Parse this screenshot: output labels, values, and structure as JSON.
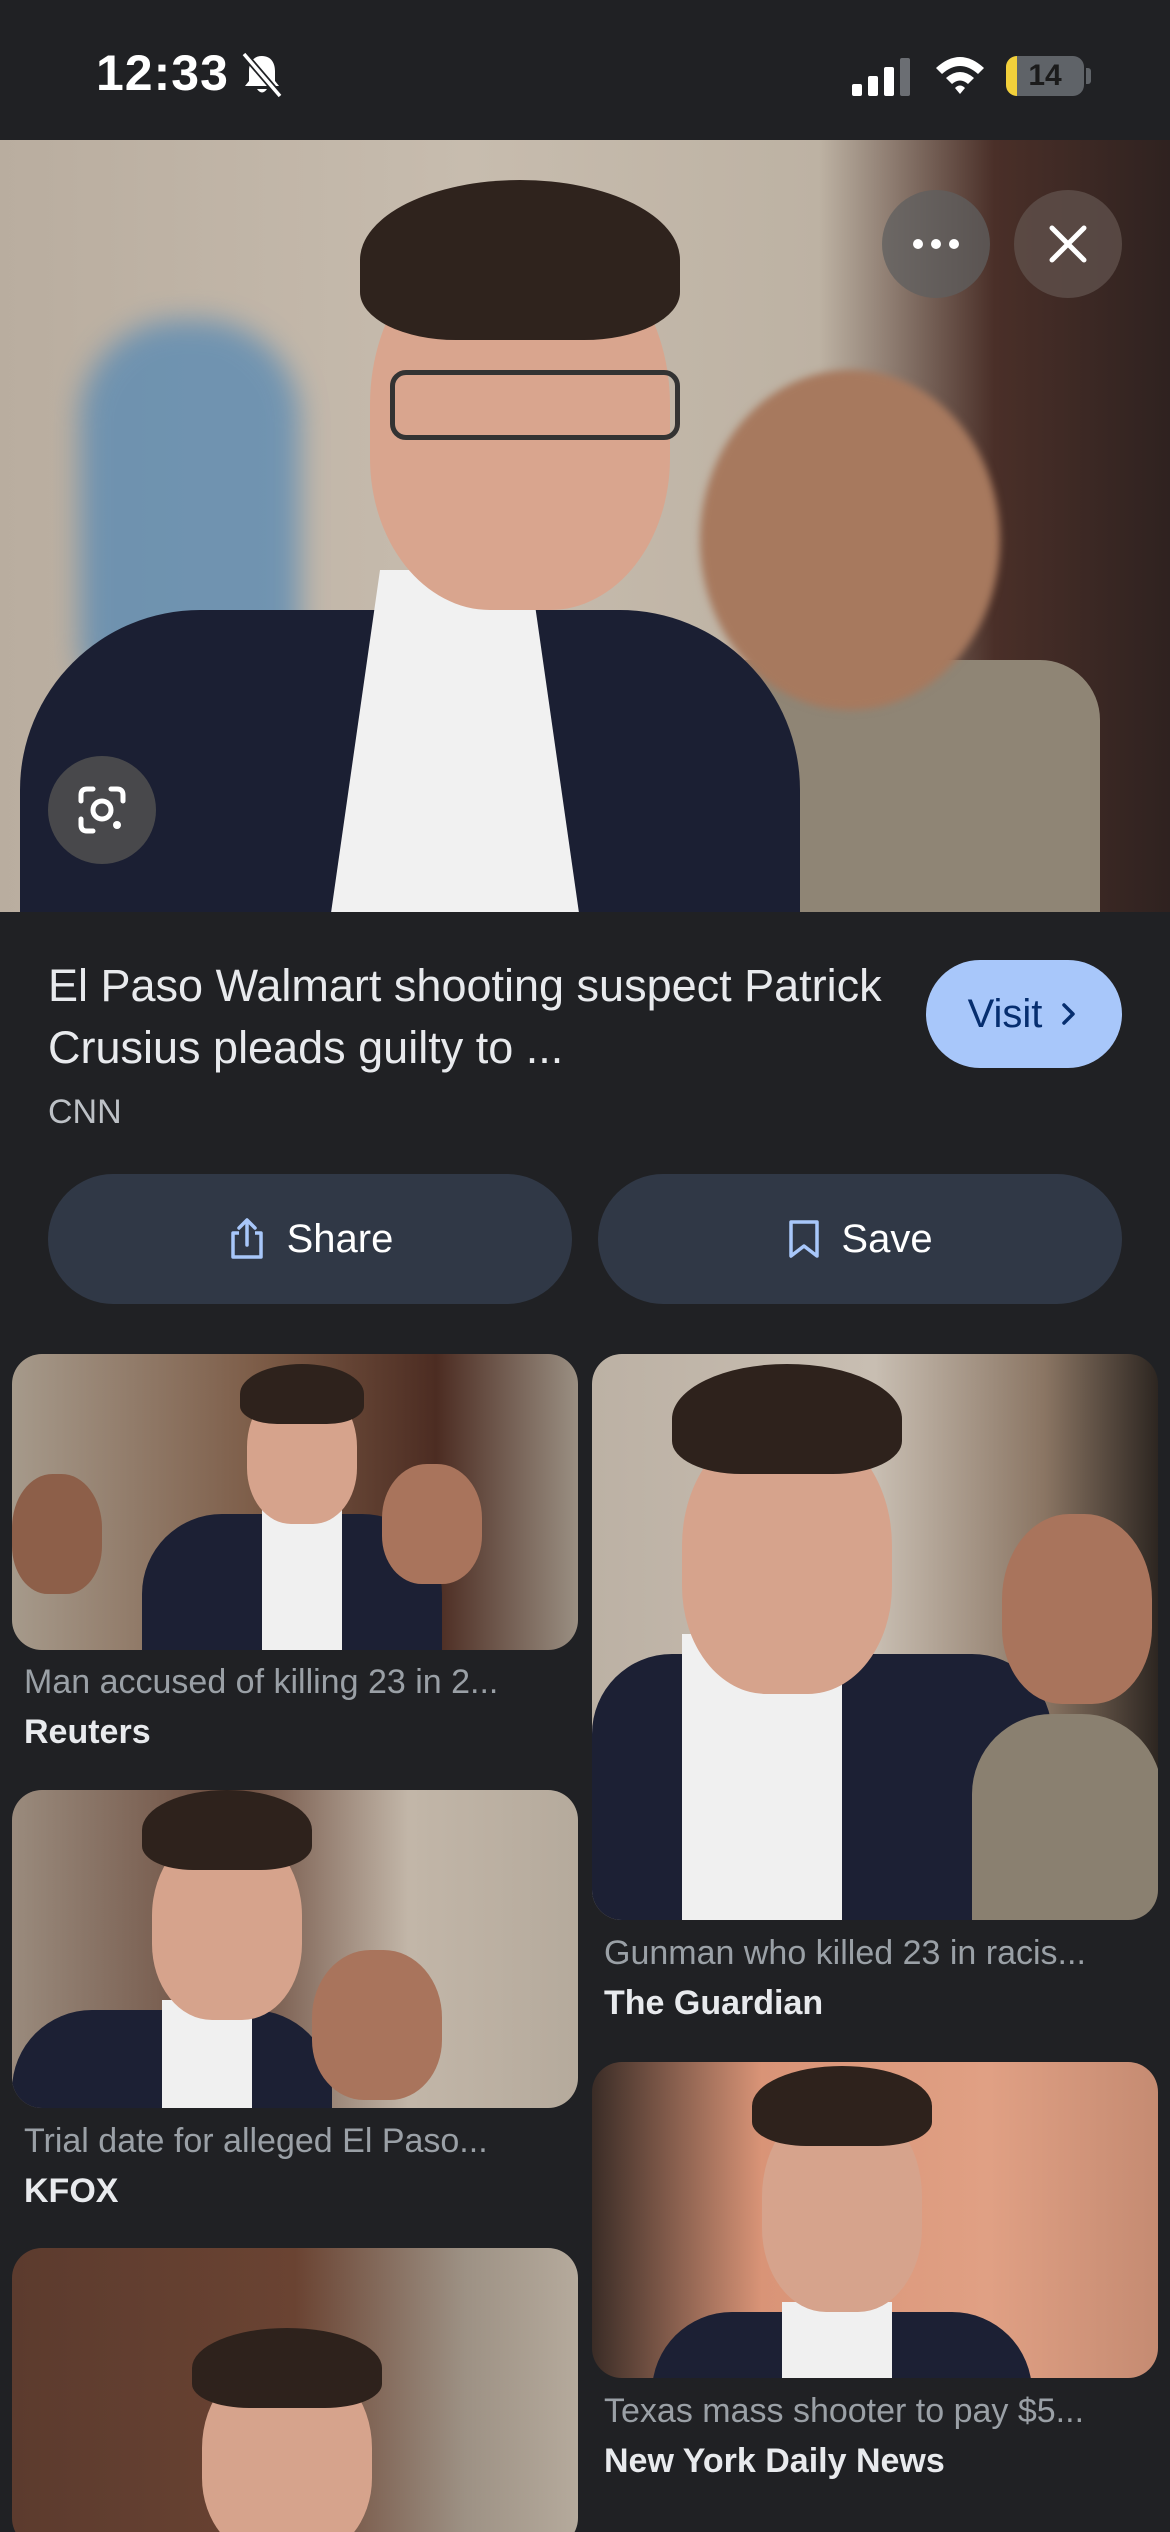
{
  "status_bar": {
    "time": "12:33",
    "battery_level": "14",
    "battery_fraction": 0.14
  },
  "hero": {
    "more_icon": "more-horiz-icon",
    "close_icon": "close-icon",
    "lens_icon": "lens-icon"
  },
  "result": {
    "title": "El Paso Walmart shooting suspect Patrick Crusius pleads guilty to ...",
    "source": "CNN",
    "visit_label": "Visit"
  },
  "actions": {
    "share_label": "Share",
    "save_label": "Save"
  },
  "related": [
    {
      "caption": "Man accused of killing 23 in 2...",
      "source": "Reuters"
    },
    {
      "caption": "Gunman who killed 23 in racis...",
      "source": "The Guardian"
    },
    {
      "caption": "Trial date for alleged El Paso...",
      "source": "KFOX"
    },
    {
      "caption": "Texas mass shooter to pay $5...",
      "source": "New York Daily News"
    }
  ],
  "colors": {
    "background": "#202124",
    "visit_button": "#a8c7fa",
    "action_button": "#303846",
    "battery_fill": "#f2d03b"
  }
}
